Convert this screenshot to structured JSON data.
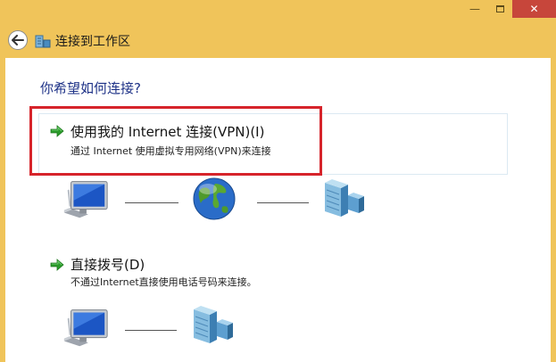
{
  "window": {
    "minimize_glyph": "—",
    "close_glyph": "✕"
  },
  "header": {
    "title": "连接到工作区",
    "back_icon": "back-arrow-icon",
    "wizard_icon": "workplace-network-icon"
  },
  "main": {
    "question": "你希望如何连接?",
    "options": [
      {
        "title": "使用我的 Internet 连接(VPN)(I)",
        "description": "通过 Internet 使用虚拟专用网络(VPN)来连接",
        "icon": "green-arrow-icon",
        "diagram": [
          "computer-icon",
          "globe-icon",
          "server-icon"
        ]
      },
      {
        "title": "直接拨号(D)",
        "description": "不通过Internet直接使用电话号码来连接。",
        "icon": "green-arrow-icon",
        "diagram": [
          "computer-icon",
          "server-icon"
        ]
      }
    ]
  },
  "colors": {
    "titlebar": "#f0c45a",
    "close_button": "#c7463b",
    "question_text": "#1e3287",
    "highlight_box": "#d6242b",
    "option_border": "#dbe9f2"
  }
}
